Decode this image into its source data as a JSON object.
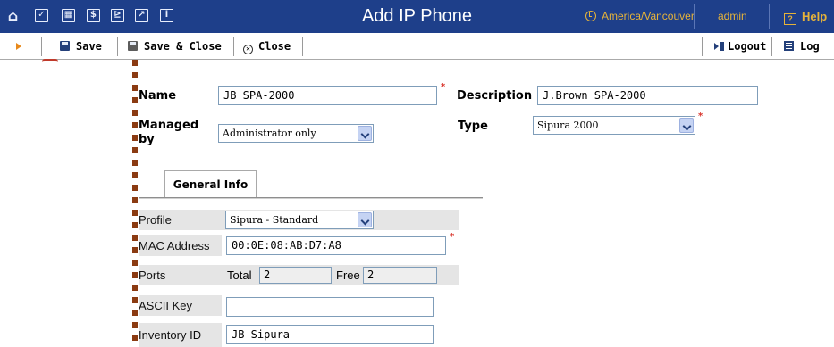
{
  "header": {
    "title": "Add IP Phone",
    "timezone": "America/Vancouver",
    "user": "admin",
    "help": "Help",
    "nav_icons": [
      "home-icon",
      "check-icon",
      "grid-icon",
      "dollar-icon",
      "phone-icon",
      "chart-icon",
      "info-icon"
    ],
    "bar_color": "#1e3f8a",
    "accent_color": "#e6b33a"
  },
  "toolbar": {
    "save": "Save",
    "save_close": "Save & Close",
    "close": "Close",
    "logout": "Logout",
    "log": "Log"
  },
  "form": {
    "name_label": "Name",
    "name_value": "JB SPA-2000",
    "description_label": "Description",
    "description_value": "J.Brown SPA-2000",
    "managed_label_1": "Managed",
    "managed_label_2": "by",
    "managed_value": "Administrator only",
    "type_label": "Type",
    "type_value": "Sipura 2000",
    "required_mark": "*"
  },
  "tabs": [
    {
      "label": "General Info",
      "active": true
    }
  ],
  "general_info": {
    "profile_label": "Profile",
    "profile_value": "Sipura - Standard",
    "mac_label": "MAC Address",
    "mac_value": "00:0E:08:AB:D7:A8",
    "ports_label": "Ports",
    "ports_total_label": "Total",
    "ports_total_value": "2",
    "ports_free_label": "Free",
    "ports_free_value": "2",
    "ascii_label": "ASCII Key",
    "ascii_value": "",
    "inventory_label": "Inventory ID",
    "inventory_value": "JB Sipura"
  }
}
